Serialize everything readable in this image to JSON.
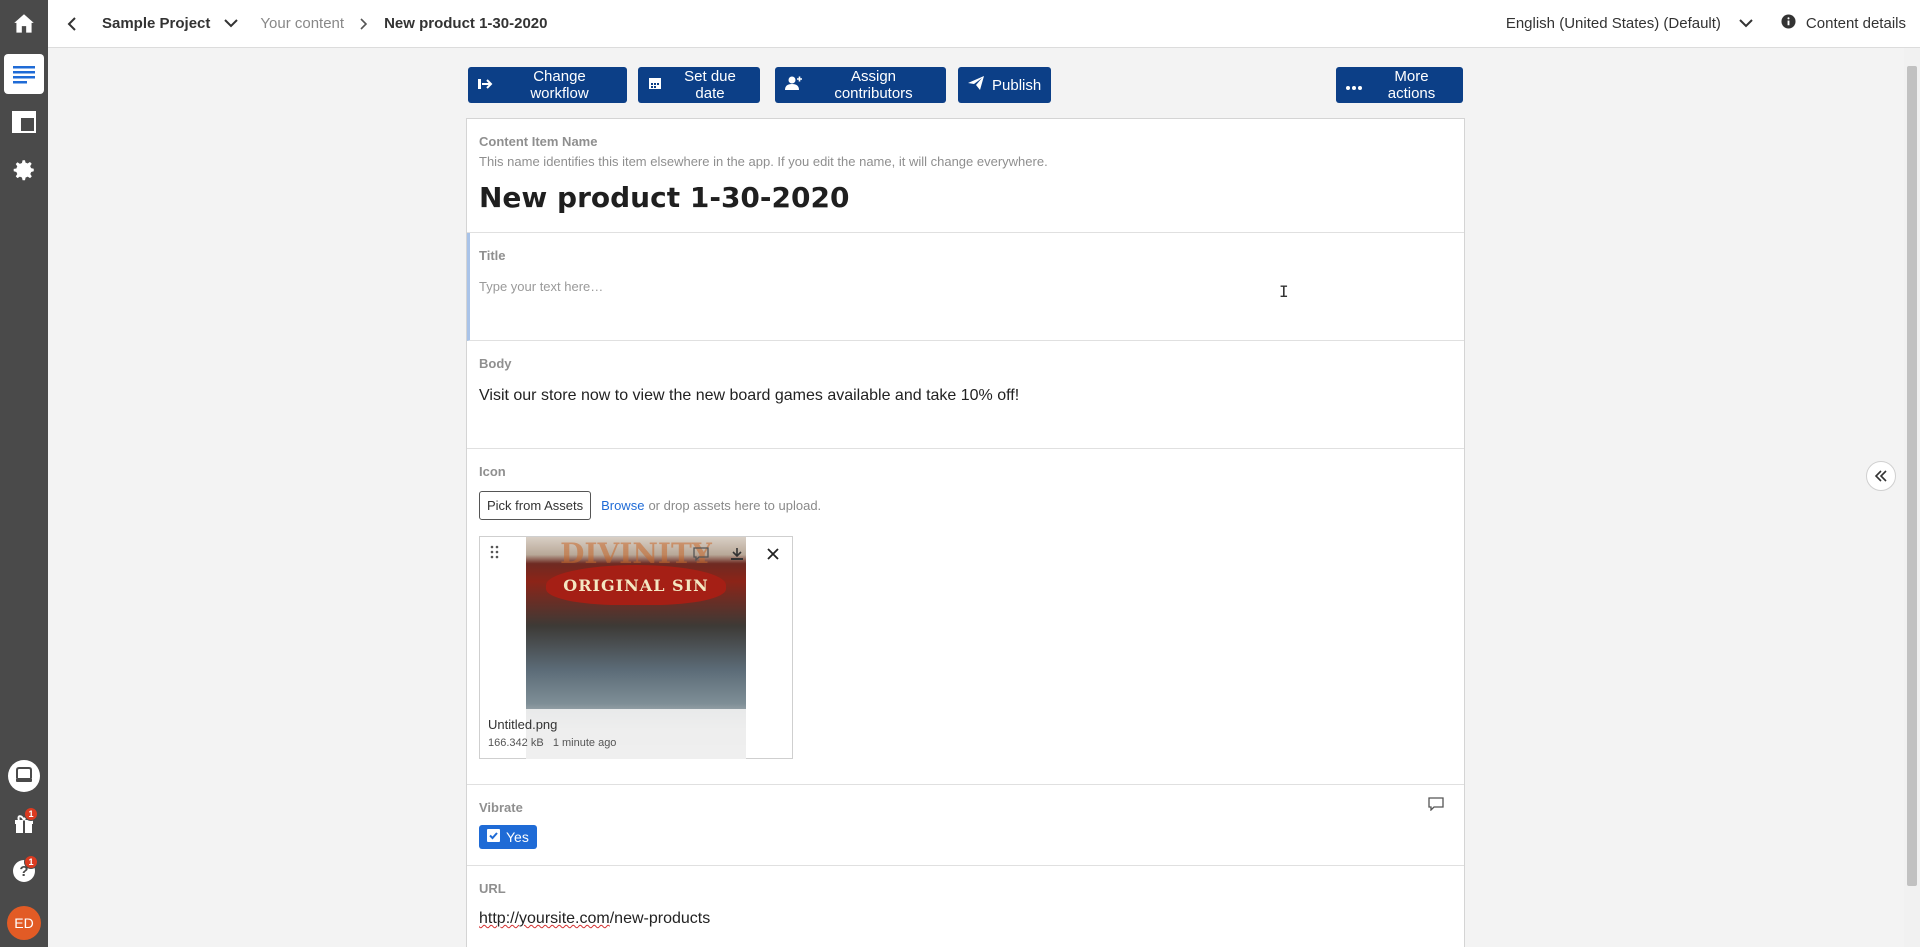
{
  "sidebar": {
    "items": [
      {
        "name": "home",
        "icon": "home-icon"
      },
      {
        "name": "content",
        "icon": "content-list-icon",
        "active": true
      },
      {
        "name": "layout",
        "icon": "layout-icon"
      },
      {
        "name": "settings",
        "icon": "gear-icon"
      },
      {
        "name": "feedback",
        "icon": "feedback-icon"
      },
      {
        "name": "gifts",
        "icon": "gift-icon",
        "badge": "1"
      },
      {
        "name": "help",
        "icon": "help-icon",
        "badge": "1"
      }
    ],
    "avatar_initials": "ED"
  },
  "topbar": {
    "project": "Sample Project",
    "breadcrumb_parent": "Your content",
    "breadcrumb_current": "New product 1-30-2020",
    "language": "English (United States) (Default)",
    "content_details": "Content details"
  },
  "actions": {
    "change_workflow": "Change workflow",
    "set_due_date": "Set due date",
    "assign_contributors": "Assign contributors",
    "publish": "Publish",
    "more_actions": "More actions"
  },
  "content_item_name": {
    "label": "Content Item Name",
    "help": "This name identifies this item elsewhere in the app. If you edit the name, it will change everywhere.",
    "value": "New product 1-30-2020"
  },
  "title_field": {
    "label": "Title",
    "placeholder": "Type your text here…"
  },
  "body_field": {
    "label": "Body",
    "value": "Visit our store now to view the new board games available and take 10% off!"
  },
  "icon_field": {
    "label": "Icon",
    "pick_button": "Pick from Assets",
    "browse": "Browse",
    "drop_text": "or drop assets here to upload.",
    "asset": {
      "file_name": "Untitled.png",
      "size": "166.342 kB",
      "uploaded": "1 minute ago",
      "thumb_title": "ORIGINAL SIN",
      "thumb_brand": "DIVINITY"
    }
  },
  "vibrate_field": {
    "label": "Vibrate",
    "option": "Yes",
    "checked": true
  },
  "url_field": {
    "label": "URL",
    "value_prefix": "http://",
    "value_domain": "yoursite.com",
    "value_path": "/new-products"
  },
  "colors": {
    "primary": "#0c3f87",
    "sidebar": "#4a4a4a",
    "accent_blue": "#1f6bd6",
    "badge": "#db3b21",
    "avatar": "#e25b25"
  }
}
